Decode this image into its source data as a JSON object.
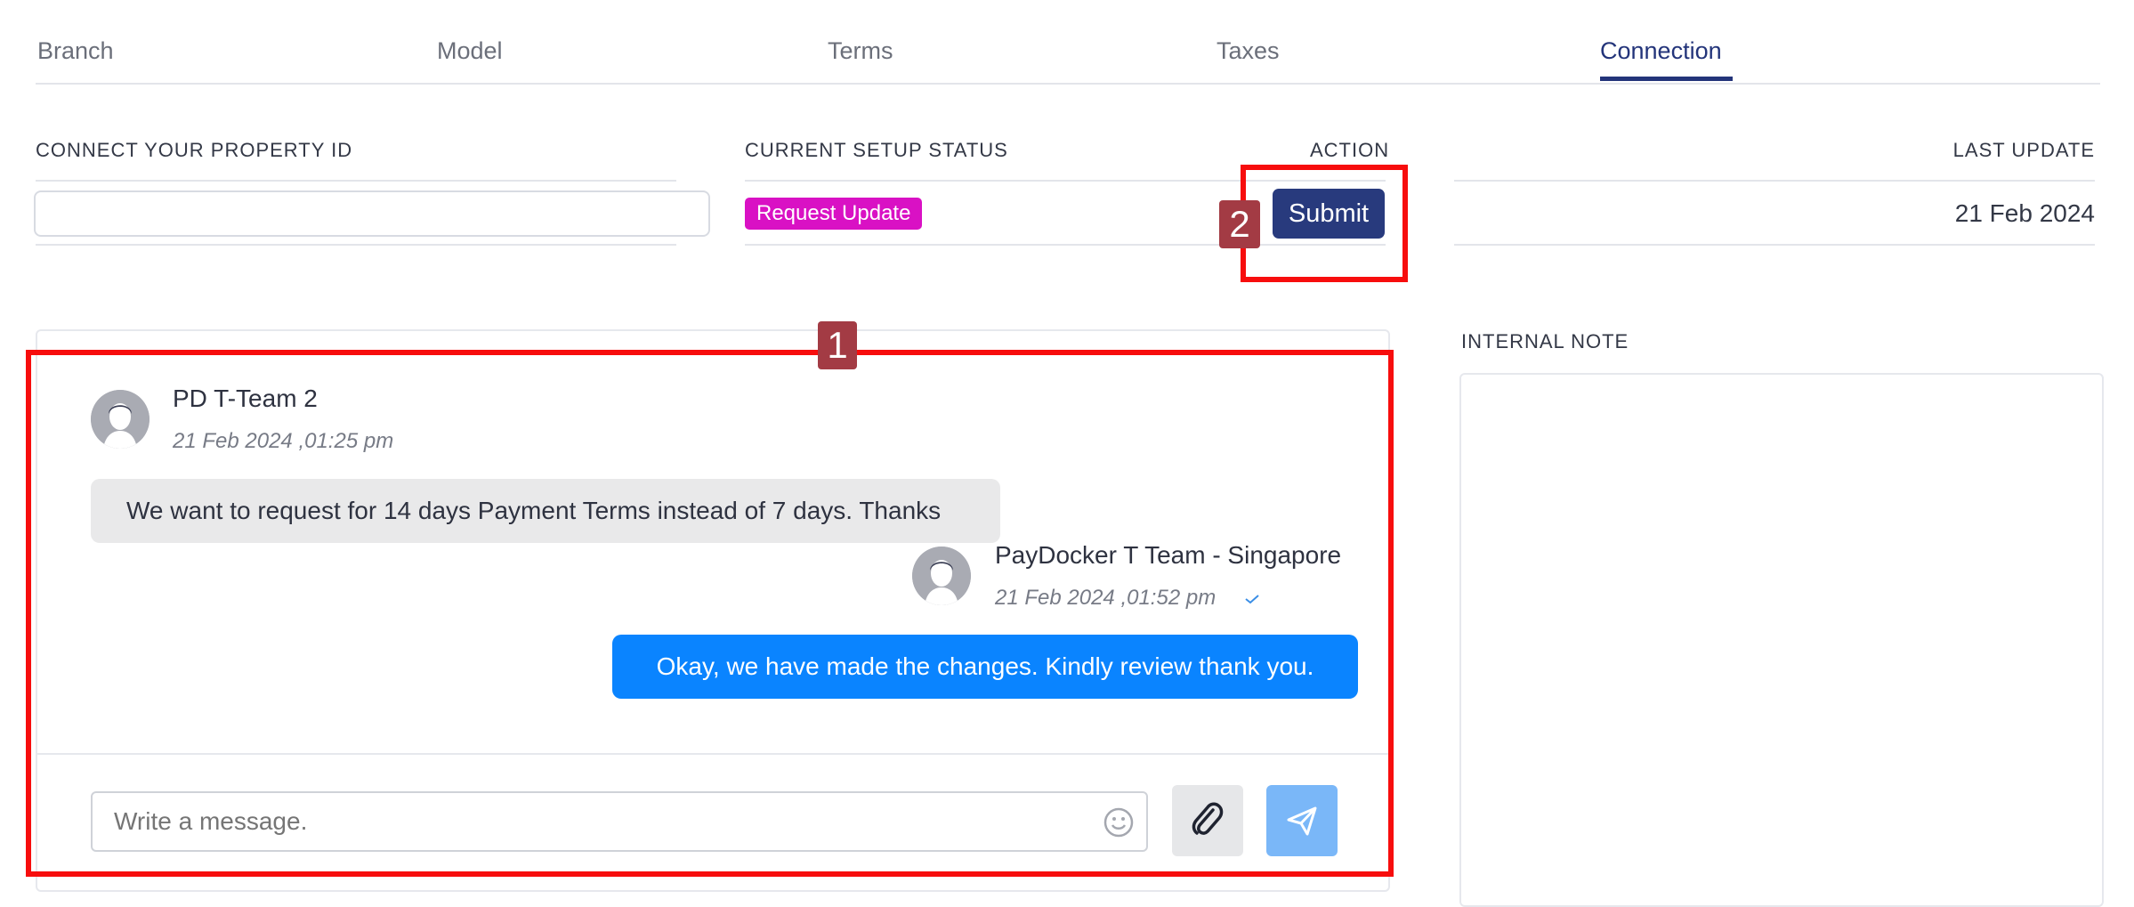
{
  "tabs": [
    {
      "label": "Branch"
    },
    {
      "label": "Model"
    },
    {
      "label": "Terms"
    },
    {
      "label": "Taxes"
    },
    {
      "label": "Connection"
    }
  ],
  "active_tab": "Connection",
  "setup": {
    "property_id_header": "CONNECT YOUR PROPERTY ID",
    "property_id_value": "",
    "status_header": "CURRENT SETUP STATUS",
    "status_badge": "Request Update",
    "action_header": "ACTION",
    "submit_label": "Submit",
    "last_update_header": "LAST UPDATE",
    "last_update_value": "21 Feb 2024"
  },
  "chat": {
    "messages": [
      {
        "sender": "PD T-Team 2",
        "timestamp": "21 Feb 2024 ,01:25 pm",
        "text": "We want to request for 14 days Payment Terms instead of 7 days. Thanks",
        "direction": "incoming"
      },
      {
        "sender": "PayDocker T Team - Singapore",
        "timestamp": "21 Feb 2024 ,01:52 pm",
        "text": "Okay, we have made the changes. Kindly review thank you.",
        "direction": "outgoing",
        "read_icon": "check-icon"
      }
    ],
    "input_placeholder": "Write a message.",
    "emoji_icon": "smiley-icon",
    "attach_icon": "paperclip-icon",
    "send_icon": "paper-plane-icon"
  },
  "internal_note": {
    "header": "INTERNAL NOTE",
    "value": ""
  },
  "annotations": [
    {
      "number": "1"
    },
    {
      "number": "2"
    }
  ],
  "colors": {
    "accent": "#23347a",
    "badge": "#d911c4",
    "outgoing_bubble": "#0a84ff",
    "annotation": "#f70d0d"
  }
}
